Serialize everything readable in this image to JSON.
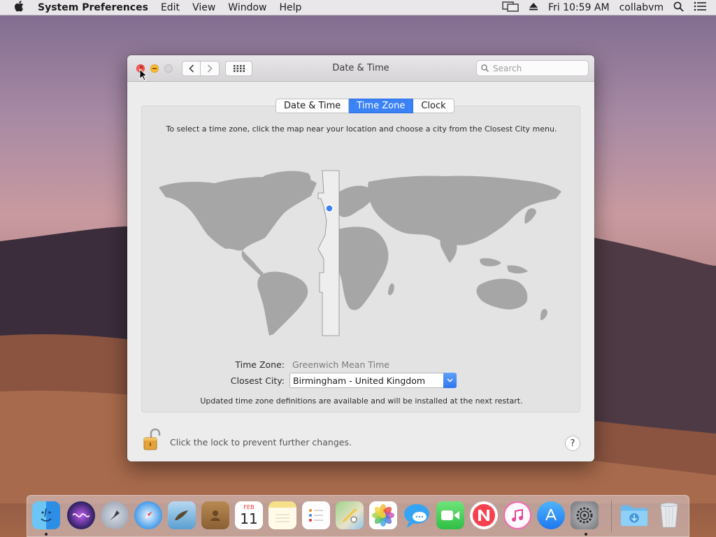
{
  "menubar": {
    "apple": "",
    "app_name": "System Preferences",
    "menus": [
      "Edit",
      "View",
      "Window",
      "Help"
    ],
    "clock": "Fri 10:59 AM",
    "user": "collabvm"
  },
  "window": {
    "title": "Date & Time",
    "search_placeholder": "Search",
    "tabs": [
      {
        "label": "Date & Time",
        "active": false
      },
      {
        "label": "Time Zone",
        "active": true
      },
      {
        "label": "Clock",
        "active": false
      }
    ],
    "instructions": "To select a time zone, click the map near your location and choose a city from the Closest City menu.",
    "time_zone_label": "Time Zone:",
    "time_zone_value": "Greenwich Mean Time",
    "closest_city_label": "Closest City:",
    "closest_city_value": "Birmingham - United Kingdom",
    "update_note": "Updated time zone definitions are available and will be installed at the next restart.",
    "lock_text": "Click the lock to prevent further changes.",
    "help_label": "?"
  },
  "dock": {
    "calendar_month": "FEB",
    "calendar_day": "11",
    "apps": [
      "Finder",
      "Siri",
      "Launchpad",
      "Safari",
      "Mail",
      "Contacts",
      "Calendar",
      "Notes",
      "Reminders",
      "Maps",
      "Photos",
      "Messages",
      "FaceTime",
      "News",
      "iTunes",
      "App Store",
      "System Preferences",
      "Downloads",
      "Trash"
    ]
  },
  "colors": {
    "accent": "#3a82f6",
    "close": "#fc5f57",
    "minimize": "#fdbc2e"
  }
}
